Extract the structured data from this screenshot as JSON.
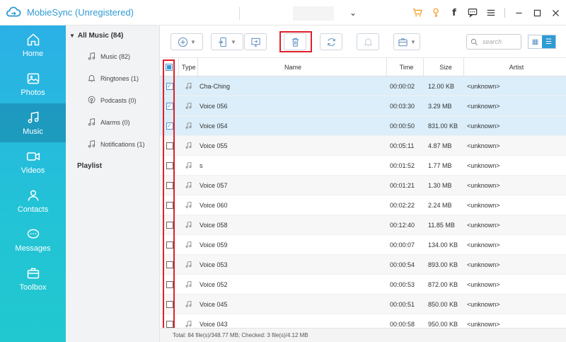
{
  "app": {
    "title": "MobieSync (Unregistered)",
    "accent": "#2f9bd3",
    "highlight_color": "#e0202a"
  },
  "window_controls": [
    "cart-icon",
    "key-icon",
    "facebook-icon",
    "feedback-icon",
    "menu-icon",
    "minimize-icon",
    "maximize-icon",
    "close-icon"
  ],
  "sidebar": {
    "items": [
      {
        "label": "Home",
        "icon": "home-icon"
      },
      {
        "label": "Photos",
        "icon": "photos-icon"
      },
      {
        "label": "Music",
        "icon": "music-icon",
        "active": true
      },
      {
        "label": "Videos",
        "icon": "videos-icon"
      },
      {
        "label": "Contacts",
        "icon": "contacts-icon"
      },
      {
        "label": "Messages",
        "icon": "messages-icon"
      },
      {
        "label": "Toolbox",
        "icon": "toolbox-icon"
      }
    ]
  },
  "categories": {
    "header": "All Music (84)",
    "items": [
      {
        "label": "Music (82)",
        "icon": "music-note-icon"
      },
      {
        "label": "Ringtones (1)",
        "icon": "bell-icon"
      },
      {
        "label": "Podcasts (0)",
        "icon": "podcast-icon"
      },
      {
        "label": "Alarms (0)",
        "icon": "alarm-icon"
      },
      {
        "label": "Notifications (1)",
        "icon": "notification-icon"
      }
    ],
    "playlist": "Playlist"
  },
  "toolbar": {
    "buttons": [
      "add-icon",
      "export-to-device-icon",
      "export-to-pc-icon",
      "delete-icon",
      "sync-icon",
      "ringtone-icon",
      "toolbox-icon"
    ],
    "search_placeholder": "search"
  },
  "table": {
    "headers": {
      "type": "Type",
      "name": "Name",
      "time": "Time",
      "size": "Size",
      "artist": "Artist"
    },
    "rows": [
      {
        "checked": true,
        "name": "Cha-Ching",
        "time": "00:00:02",
        "size": "12.00 KB",
        "artist": "<unknown>"
      },
      {
        "checked": true,
        "name": "Voice 056",
        "time": "00:03:30",
        "size": "3.29 MB",
        "artist": "<unknown>"
      },
      {
        "checked": true,
        "name": "Voice 054",
        "time": "00:00:50",
        "size": "831.00 KB",
        "artist": "<unknown>"
      },
      {
        "checked": false,
        "name": "Voice 055",
        "time": "00:05:11",
        "size": "4.87 MB",
        "artist": "<unknown>"
      },
      {
        "checked": false,
        "name": "s",
        "time": "00:01:52",
        "size": "1.77 MB",
        "artist": "<unknown>"
      },
      {
        "checked": false,
        "name": "Voice 057",
        "time": "00:01:21",
        "size": "1.30 MB",
        "artist": "<unknown>"
      },
      {
        "checked": false,
        "name": "Voice 060",
        "time": "00:02:22",
        "size": "2.24 MB",
        "artist": "<unknown>"
      },
      {
        "checked": false,
        "name": "Voice 058",
        "time": "00:12:40",
        "size": "11.85 MB",
        "artist": "<unknown>"
      },
      {
        "checked": false,
        "name": "Voice 059",
        "time": "00:00:07",
        "size": "134.00 KB",
        "artist": "<unknown>"
      },
      {
        "checked": false,
        "name": "Voice 053",
        "time": "00:00:54",
        "size": "893.00 KB",
        "artist": "<unknown>"
      },
      {
        "checked": false,
        "name": "Voice 052",
        "time": "00:00:53",
        "size": "872.00 KB",
        "artist": "<unknown>"
      },
      {
        "checked": false,
        "name": "Voice 045",
        "time": "00:00:51",
        "size": "850.00 KB",
        "artist": "<unknown>"
      },
      {
        "checked": false,
        "name": "Voice 043",
        "time": "00:00:58",
        "size": "950.00 KB",
        "artist": "<unknown>"
      }
    ]
  },
  "status": "Total: 84 file(s)/348.77 MB; Checked: 3 file(s)/4.12 MB"
}
